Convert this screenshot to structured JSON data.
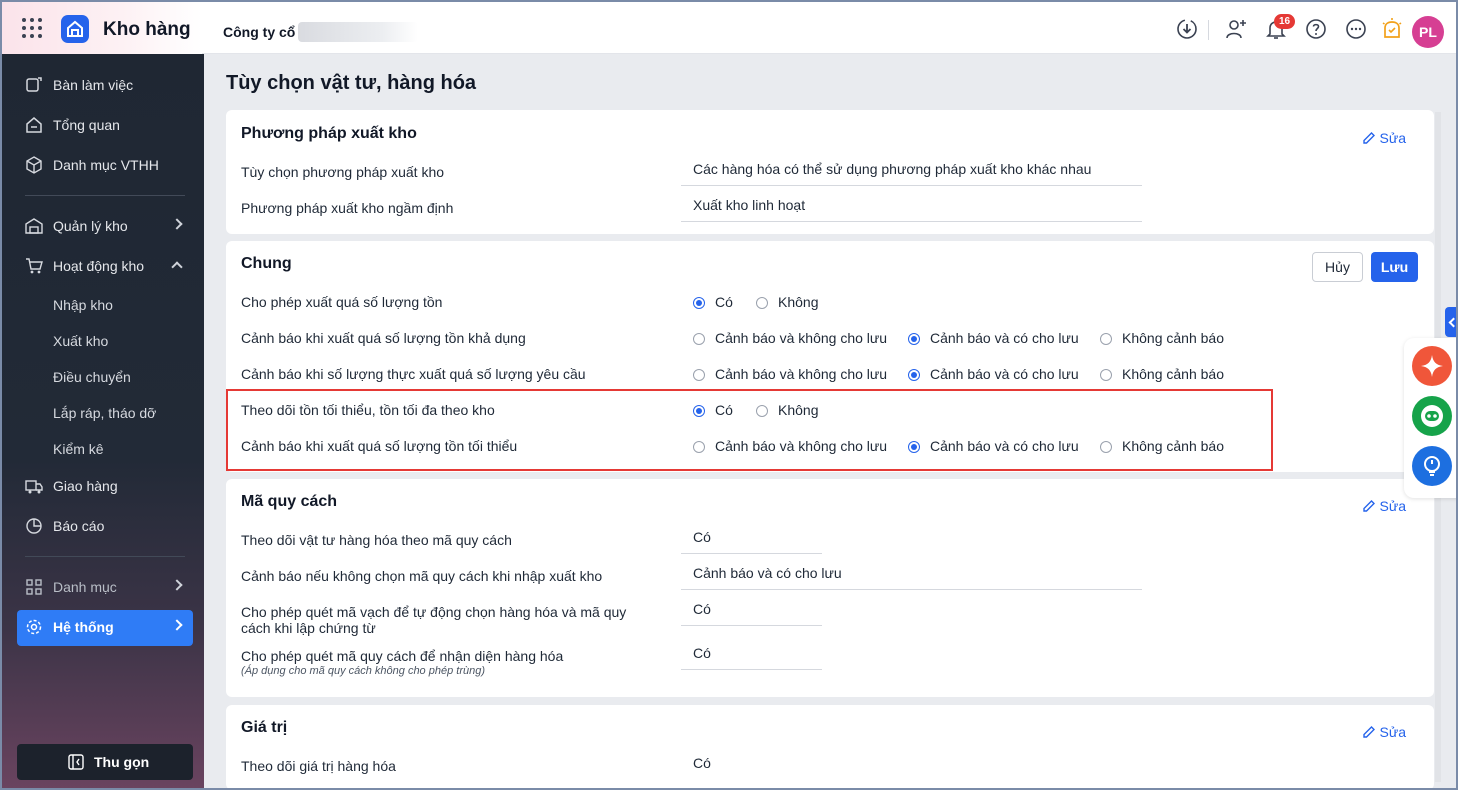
{
  "topbar": {
    "app_title": "Kho hàng",
    "company": "Công ty cổ p",
    "notification_count": "16",
    "avatar_initials": "PL"
  },
  "sidebar": {
    "items": [
      {
        "label": "Bàn làm việc",
        "icon": "workspace-icon"
      },
      {
        "label": "Tổng quan",
        "icon": "overview-icon"
      },
      {
        "label": "Danh mục VTHH",
        "icon": "box-icon"
      },
      {
        "label": "Quản lý kho",
        "icon": "warehouse-icon"
      },
      {
        "label": "Hoạt động kho",
        "icon": "cart-icon"
      },
      {
        "label": "Giao hàng",
        "icon": "truck-icon"
      },
      {
        "label": "Báo cáo",
        "icon": "pie-chart-icon"
      },
      {
        "label": "Danh mục",
        "icon": "grid-icon"
      },
      {
        "label": "Hệ thống",
        "icon": "gear-icon"
      }
    ],
    "sub_items": [
      "Nhập kho",
      "Xuất kho",
      "Điều chuyển",
      "Lắp ráp, tháo dỡ",
      "Kiểm kê"
    ],
    "collapse_label": "Thu gọn"
  },
  "page": {
    "title": "Tùy chọn vật tư, hàng hóa",
    "edit_label": "Sửa"
  },
  "section_export": {
    "title": "Phương pháp xuất kho",
    "rows": [
      {
        "label": "Tùy chọn phương pháp xuất kho",
        "value": "Các hàng hóa có thể sử dụng phương pháp xuất kho khác nhau"
      },
      {
        "label": "Phương pháp xuất kho ngầm định",
        "value": "Xuất kho linh hoạt"
      }
    ]
  },
  "section_general": {
    "title": "Chung",
    "cancel_label": "Hủy",
    "save_label": "Lưu",
    "yes": "Có",
    "no": "Không",
    "warn_block": "Cảnh báo và không cho lưu",
    "warn_allow": "Cảnh báo và có cho lưu",
    "no_warn": "Không cảnh báo",
    "rows": [
      {
        "label": "Cho phép xuất quá số lượng tồn",
        "selected": "Có"
      },
      {
        "label": "Cảnh báo khi xuất quá số lượng tồn khả dụng",
        "selected": "Cảnh báo và có cho lưu"
      },
      {
        "label": "Cảnh báo khi số lượng thực xuất quá số lượng yêu cầu",
        "selected": "Cảnh báo và có cho lưu"
      },
      {
        "label": "Theo dõi tồn tối thiểu, tồn tối đa theo kho",
        "selected": "Có"
      },
      {
        "label": "Cảnh báo khi xuất quá số lượng tồn tối thiểu",
        "selected": "Cảnh báo và có cho lưu"
      }
    ]
  },
  "section_spec": {
    "title": "Mã quy cách",
    "rows": [
      {
        "label": "Theo dõi vật tư hàng hóa theo mã quy cách",
        "value": "Có"
      },
      {
        "label": "Cảnh báo nếu không chọn mã quy cách khi nhập xuất kho",
        "value": "Cảnh báo và có cho lưu"
      },
      {
        "label_line1": "Cho phép quét mã vạch để tự động chọn hàng hóa và mã quy",
        "label_line2": "cách khi lập chứng từ",
        "value": "Có"
      },
      {
        "label": "Cho phép quét mã quy cách để nhận diện hàng hóa",
        "note": "(Áp dụng cho mã quy cách không cho phép trùng)",
        "value": "Có"
      }
    ]
  },
  "section_value": {
    "title": "Giá trị",
    "rows": [
      {
        "label": "Theo dõi giá trị hàng hóa",
        "value": "Có"
      }
    ]
  },
  "colors": {
    "accent": "#2563eb",
    "highlight": "#e53935",
    "sidebar_bg": "#1f2733",
    "active_item": "#2f7cf6"
  }
}
